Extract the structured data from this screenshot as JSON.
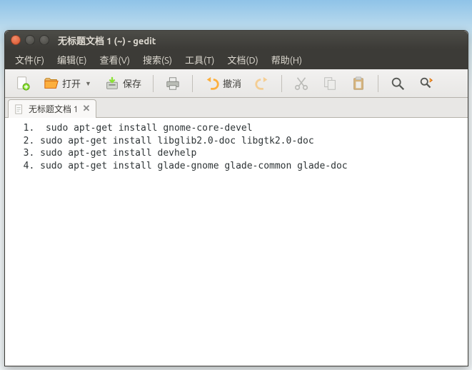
{
  "window": {
    "title": "无标题文档 1 (~) - gedit"
  },
  "menubar": {
    "file": "文件(F)",
    "edit": "编辑(E)",
    "view": "查看(V)",
    "search": "搜索(S)",
    "tools": "工具(T)",
    "documents": "文档(D)",
    "help": "帮助(H)"
  },
  "toolbar": {
    "open_label": "打开",
    "save_label": "保存",
    "undo_label": "撤消"
  },
  "tab": {
    "label": "无标题文档 1"
  },
  "editor": {
    "content": "  1.  sudo apt-get install gnome-core-devel\n  2. sudo apt-get install libglib2.0-doc libgtk2.0-doc\n  3. sudo apt-get install devhelp\n  4. sudo apt-get install glade-gnome glade-common glade-doc"
  }
}
